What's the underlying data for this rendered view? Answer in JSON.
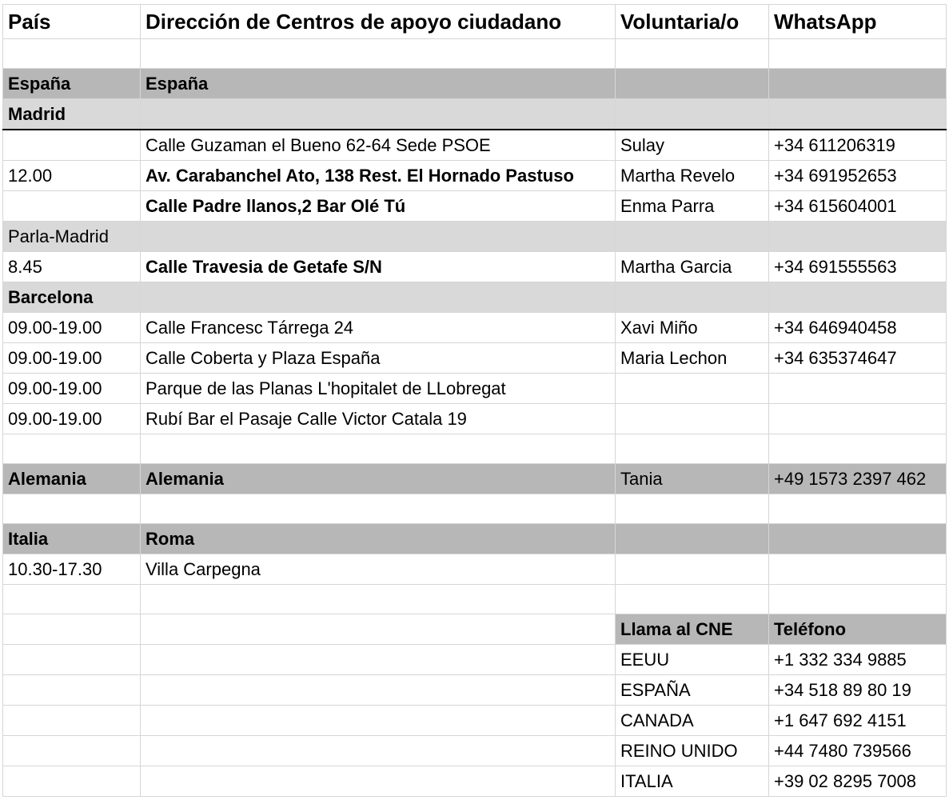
{
  "headers": {
    "pais": "País",
    "direccion": "Dirección de Centros de apoyo ciudadano",
    "voluntario": "Voluntaria/o",
    "whatsapp": "WhatsApp"
  },
  "espana": {
    "country": "España",
    "region": "España",
    "madrid": {
      "label": "Madrid",
      "rows": [
        {
          "time": "",
          "address": "Calle Guzaman el Bueno 62-64  Sede PSOE",
          "volunteer": "Sulay",
          "phone": "+34 611206319"
        },
        {
          "time": "12.00",
          "address": "Av. Carabanchel Ato, 138 Rest. El Hornado Pastuso",
          "volunteer": "Martha Revelo",
          "phone": "+34 691952653"
        },
        {
          "time": "",
          "address": "Calle Padre llanos,2  Bar Olé Tú",
          "volunteer": "Enma Parra",
          "phone": "+34 615604001"
        }
      ]
    },
    "parla": {
      "label": "Parla-Madrid",
      "rows": [
        {
          "time": "8.45",
          "address": "Calle Travesia de Getafe S/N",
          "volunteer": "Martha Garcia",
          "phone": "+34 691555563"
        }
      ]
    },
    "barcelona": {
      "label": "Barcelona",
      "rows": [
        {
          "time": "09.00-19.00",
          "address": "Calle Francesc Tárrega 24",
          "volunteer": "Xavi Miño",
          "phone": "+34 646940458"
        },
        {
          "time": "09.00-19.00",
          "address": "Calle Coberta y Plaza España",
          "volunteer": "Maria Lechon",
          "phone": "+34 635374647"
        },
        {
          "time": "09.00-19.00",
          "address": "Parque de las Planas L'hopitalet de LLobregat",
          "volunteer": "",
          "phone": ""
        },
        {
          "time": "09.00-19.00",
          "address": "Rubí Bar el Pasaje Calle Victor Catala 19",
          "volunteer": "",
          "phone": ""
        }
      ]
    }
  },
  "alemania": {
    "country": "Alemania",
    "region": "Alemania",
    "volunteer": "Tania",
    "phone": "+49 1573 2397 462"
  },
  "italia": {
    "country": "Italia",
    "region": "Roma",
    "rows": [
      {
        "time": "10.30-17.30",
        "address": "Villa Carpegna"
      }
    ]
  },
  "cne": {
    "header_label": "Llama al CNE",
    "header_phone": "Teléfono",
    "rows": [
      {
        "country": "EEUU",
        "phone": "+1 332 334 9885"
      },
      {
        "country": "ESPAÑA",
        "phone": "+34 518 89 80 19"
      },
      {
        "country": "CANADA",
        "phone": "+1 647 692 4151"
      },
      {
        "country": "REINO UNIDO",
        "phone": "+44 7480 739566"
      },
      {
        "country": "ITALIA",
        "phone": "+39 02 8295 7008"
      }
    ]
  }
}
